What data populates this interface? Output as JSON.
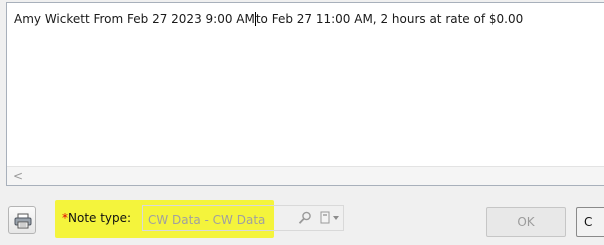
{
  "notes": {
    "text_before_caret": "Amy Wickett From Feb 27 2023 9:00 AM",
    "text_after_caret": "to Feb 27 11:00 AM, 2 hours at rate of $0.00",
    "scroll_left_arrow": "<"
  },
  "note_type": {
    "required_marker": "*",
    "label": "Note type:",
    "value": "CW Data - CW Data"
  },
  "buttons": {
    "ok_label": "OK",
    "next_label": "C"
  },
  "colors": {
    "highlight": "#f4f43c",
    "required": "#e00000"
  },
  "icons": {
    "print": "printer-icon",
    "search": "search-icon",
    "picker": "picker-dropdown-icon"
  }
}
